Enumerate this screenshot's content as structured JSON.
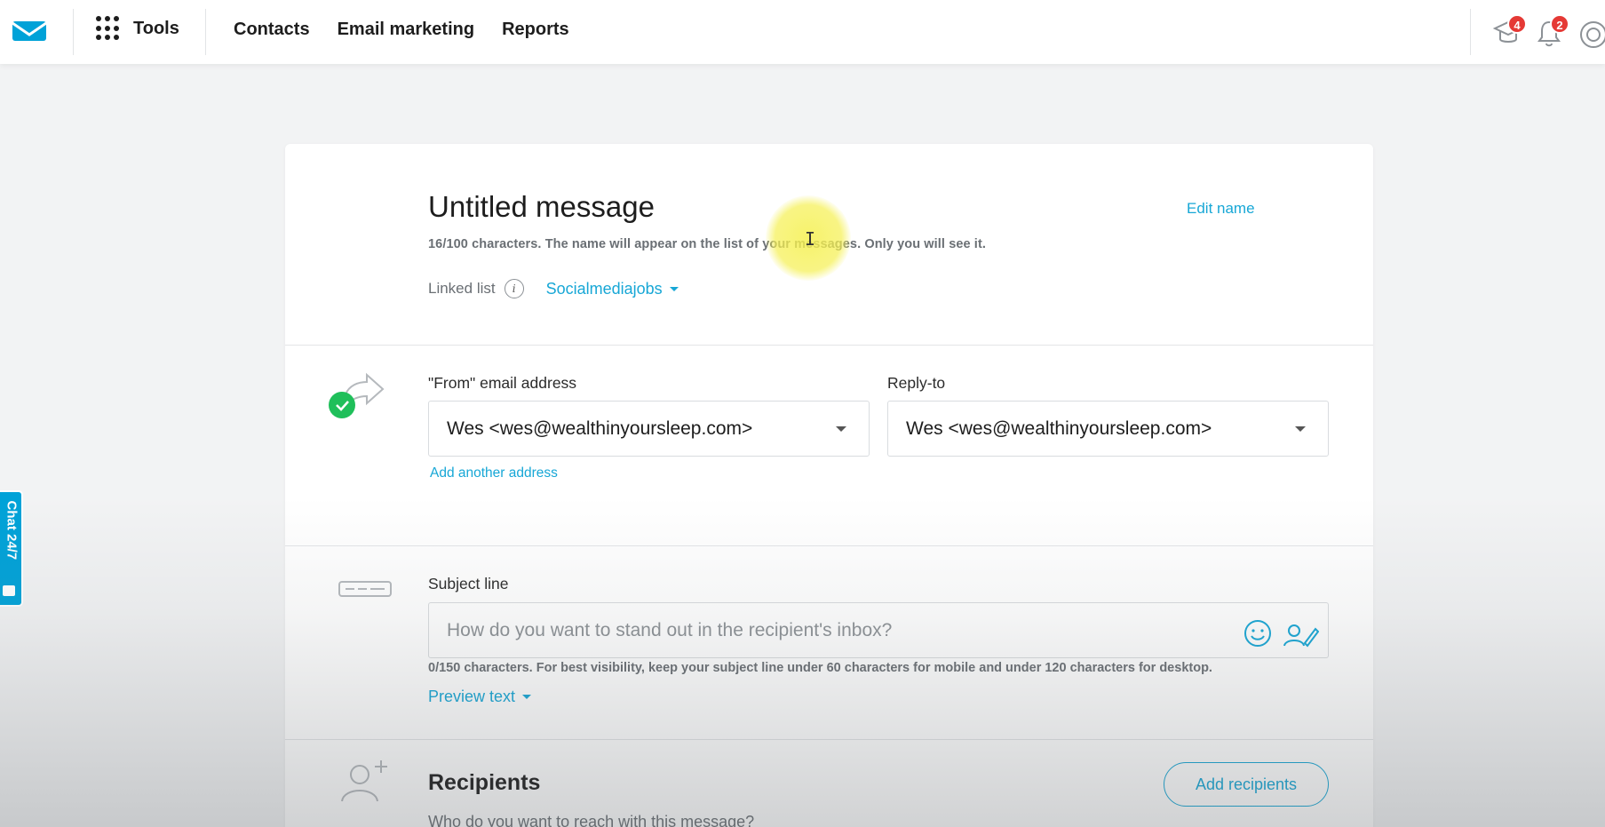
{
  "nav": {
    "tools_label": "Tools",
    "links": [
      "Contacts",
      "Email marketing",
      "Reports"
    ],
    "badges": {
      "learning": "4",
      "notifications": "2"
    }
  },
  "chat": {
    "label": "Chat 24/7"
  },
  "message": {
    "title": "Untitled message",
    "edit_name": "Edit name",
    "name_hint": "16/100 characters. The name will appear on the list of your messages. Only you will see it.",
    "linked_list_label": "Linked list",
    "linked_list_value": "Socialmediajobs"
  },
  "from": {
    "label": "\"From\" email address",
    "value": "Wes <wes@wealthinyoursleep.com>",
    "add_another": "Add another address"
  },
  "reply_to": {
    "label": "Reply-to",
    "value": "Wes <wes@wealthinyoursleep.com>"
  },
  "subject": {
    "label": "Subject line",
    "placeholder": "How do you want to stand out in the recipient's inbox?",
    "hint": "0/150 characters. For best visibility, keep your subject line under 60 characters for mobile and under 120 characters for desktop.",
    "preview_text": "Preview text"
  },
  "recipients": {
    "title": "Recipients",
    "subtitle": "Who do you want to reach with this message?",
    "add_button": "Add recipients"
  },
  "colors": {
    "accent": "#17a7d6",
    "badge": "#e53935",
    "success": "#1fbf5a"
  }
}
